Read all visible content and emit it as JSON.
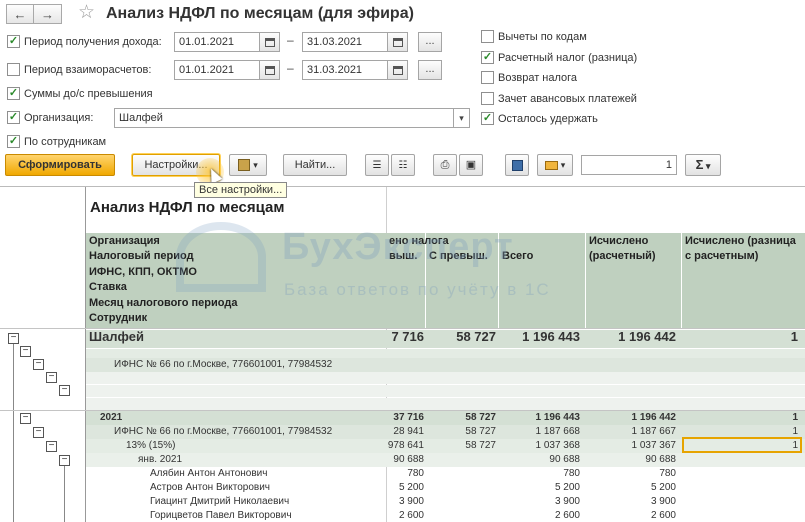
{
  "title": "Анализ НДФЛ по месяцам (для эфира)",
  "nav": {
    "back": "←",
    "forward": "→"
  },
  "filters": {
    "income_period_label": "Период получения дохода:",
    "income_from": "01.01.2021",
    "income_to": "31.03.2021",
    "settlement_period_label": "Период взаиморасчетов:",
    "settlement_from": "01.01.2021",
    "settlement_to": "31.03.2021",
    "sums_label": "Суммы до/с превышения",
    "org_label": "Организация:",
    "org_value": "Шалфей",
    "by_employees_label": "По сотрудникам",
    "dots": "...",
    "dash": "–"
  },
  "options": {
    "deductions_by_codes": "Вычеты по кодам",
    "calc_tax_diff": "Расчетный налог (разница)",
    "tax_return": "Возврат налога",
    "advance_offset": "Зачет авансовых платежей",
    "remaining_withhold": "Осталось удержать"
  },
  "toolbar": {
    "generate": "Сформировать",
    "settings": "Настройки...",
    "find": "Найти...",
    "spin_value": "1",
    "sum_symbol": "Σ",
    "tooltip": "Все настройки..."
  },
  "report": {
    "title": "Анализ НДФЛ по месяцам",
    "row_headers": [
      "Организация",
      "Налоговый период",
      "ИФНС, КПП, ОКТМО",
      "Ставка",
      "Месяц налогового периода",
      "Сотрудник"
    ],
    "col_headers": {
      "withheld_tax": "ено налога",
      "excess_cut": "выш.",
      "with_excess": "С превыш.",
      "total": "Всего",
      "calc_estimated": "Исчислено (расчетный)",
      "calc_diff": "Исчислено (разница с расчетным)"
    },
    "watermark": "БухЭксперт",
    "watermark_sub": "База ответов по учёту в 1С",
    "rows": [
      {
        "name": "Шалфей",
        "c1": "7 716",
        "c2": "58 727",
        "c3": "1 196 443",
        "c4": "1 196 442",
        "c5": "1"
      },
      {
        "name": "",
        "c1": "",
        "c2": "",
        "c3": "",
        "c4": "",
        "c5": ""
      },
      {
        "name": "ИФНС № 66 по г.Москве, 776601001, 77984532",
        "c1": "",
        "c2": "",
        "c3": "",
        "c4": "",
        "c5": ""
      },
      {
        "name": "2021",
        "c1": "37 716",
        "c2": "58 727",
        "c3": "1 196 443",
        "c4": "1 196 442",
        "c5": "1"
      },
      {
        "name": "ИФНС № 66 по г.Москве, 776601001, 77984532",
        "c1": "28 941",
        "c2": "58 727",
        "c3": "1 187 668",
        "c4": "1 187 667",
        "c5": "1"
      },
      {
        "name": "13% (15%)",
        "c1": "978 641",
        "c2": "58 727",
        "c3": "1 037 368",
        "c4": "1 037 367",
        "c5": "1"
      },
      {
        "name": "янв. 2021",
        "c1": "90 688",
        "c2": "",
        "c3": "90 688",
        "c4": "90 688",
        "c5": ""
      },
      {
        "name": "Алябин Антон Антонович",
        "c1": "780",
        "c2": "",
        "c3": "780",
        "c4": "780",
        "c5": ""
      },
      {
        "name": "Астров Антон Викторович",
        "c1": "5 200",
        "c2": "",
        "c3": "5 200",
        "c4": "5 200",
        "c5": ""
      },
      {
        "name": "Гиацинт Дмитрий Николаевич",
        "c1": "3 900",
        "c2": "",
        "c3": "3 900",
        "c4": "3 900",
        "c5": ""
      },
      {
        "name": "Горицветов Павел Викторович",
        "c1": "2 600",
        "c2": "",
        "c3": "2 600",
        "c4": "2 600",
        "c5": ""
      }
    ]
  },
  "colors": {
    "accent": "#f0a800",
    "header_bg": "#bfd0bf",
    "check": "#2c8a2c"
  }
}
